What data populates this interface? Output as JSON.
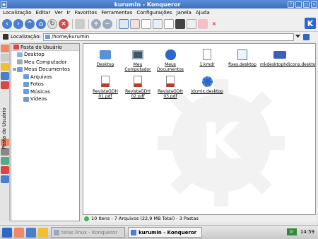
{
  "window": {
    "title": "kurumin - Konqueror"
  },
  "menu": [
    "Localização",
    "Editar",
    "Ver",
    "Ir",
    "Favoritos",
    "Ferramentas",
    "Configurações",
    "Janela",
    "Ajuda"
  ],
  "location": {
    "label": "Localização:",
    "value": "/home/kurumin"
  },
  "tree": {
    "header": "Pasta do Usuário",
    "items": [
      {
        "label": "Desktop"
      },
      {
        "label": "Meu Computador"
      },
      {
        "label": "Meus Documentos"
      },
      {
        "label": "Arquivos"
      },
      {
        "label": "Fotos"
      },
      {
        "label": "Músicas"
      },
      {
        "label": "Vídeos"
      }
    ]
  },
  "side_label": "Pasta do Usuário",
  "files": [
    {
      "label": "Desktop"
    },
    {
      "label": "Meu Computador"
    },
    {
      "label": "Meus Documentos"
    },
    {
      "label": "1.kmdr"
    },
    {
      "label": "fixes.desktop"
    },
    {
      "label": "mkdesktophdicons.desktop"
    },
    {
      "label": "RevistaGDH 01.pdf"
    },
    {
      "label": "RevistaGDH 02.pdf"
    },
    {
      "label": "RevistaGDH 03.pdf"
    },
    {
      "label": "jdcmix.desktop"
    }
  ],
  "status": "10 Itens - 7 Arquivos (22,9 MB Total) - 3 Pastas",
  "taskbar": {
    "task1": "telas linux - Konqueror",
    "task2": "kurumin - Konqueror",
    "tray": "br",
    "clock": "14:59"
  },
  "colors": {
    "accent": "#3b6fc0",
    "pdf": "#c0392b"
  }
}
